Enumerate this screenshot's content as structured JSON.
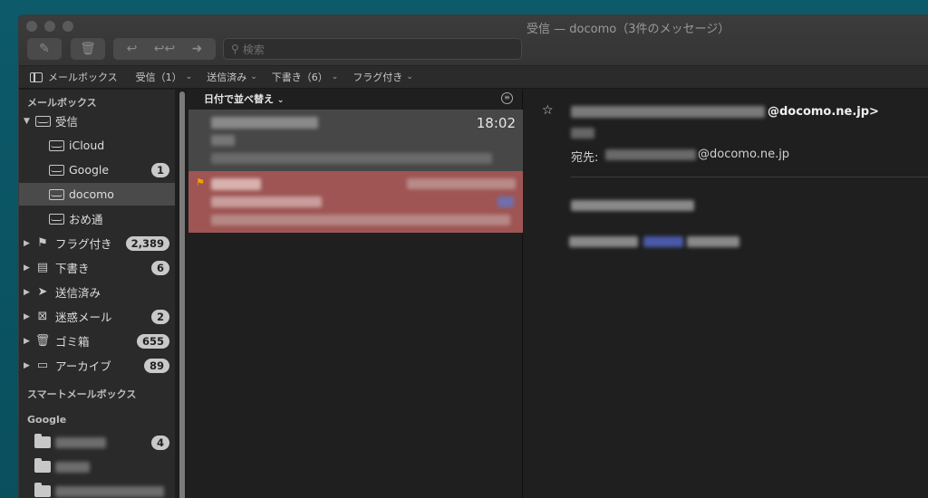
{
  "window": {
    "title": "受信 — docomo（3件のメッセージ）"
  },
  "toolbar": {
    "compose_icon": "compose-icon",
    "trash_icon": "trash-icon",
    "search_placeholder": "検索"
  },
  "favorites_bar": {
    "items": [
      {
        "label": "メールボックス"
      },
      {
        "label": "受信（1）"
      },
      {
        "label": "送信済み"
      },
      {
        "label": "下書き（6）"
      },
      {
        "label": "フラグ付き"
      }
    ]
  },
  "sidebar": {
    "mailboxes_header": "メールボックス",
    "inbox": {
      "label": "受信"
    },
    "inbox_children": [
      {
        "label": "iCloud",
        "badge": ""
      },
      {
        "label": "Google",
        "badge": "1"
      },
      {
        "label": "docomo",
        "badge": ""
      },
      {
        "label": "おめ通",
        "badge": ""
      }
    ],
    "mailboxes": [
      {
        "label": "フラグ付き",
        "badge": "2,389",
        "icon": "flag-icon"
      },
      {
        "label": "下書き",
        "badge": "6",
        "icon": "draft-icon"
      },
      {
        "label": "送信済み",
        "badge": "",
        "icon": "paper-plane-icon"
      },
      {
        "label": "迷惑メール",
        "badge": "2",
        "icon": "junk-icon"
      },
      {
        "label": "ゴミ箱",
        "badge": "655",
        "icon": "trash-icon"
      },
      {
        "label": "アーカイブ",
        "badge": "89",
        "icon": "archive-icon"
      }
    ],
    "smart_header": "スマートメールボックス",
    "google_header": "Google",
    "google_folders": [
      {
        "badge": "4"
      },
      {
        "badge": ""
      },
      {
        "badge": ""
      }
    ]
  },
  "message_list": {
    "sort_label": "日付で並べ替え",
    "messages": [
      {
        "time": "18:02"
      },
      {
        "time": ""
      }
    ]
  },
  "preview": {
    "from_domain": "@docomo.ne.jp>",
    "to_label": "宛先:",
    "to_domain": "@docomo.ne.jp"
  }
}
